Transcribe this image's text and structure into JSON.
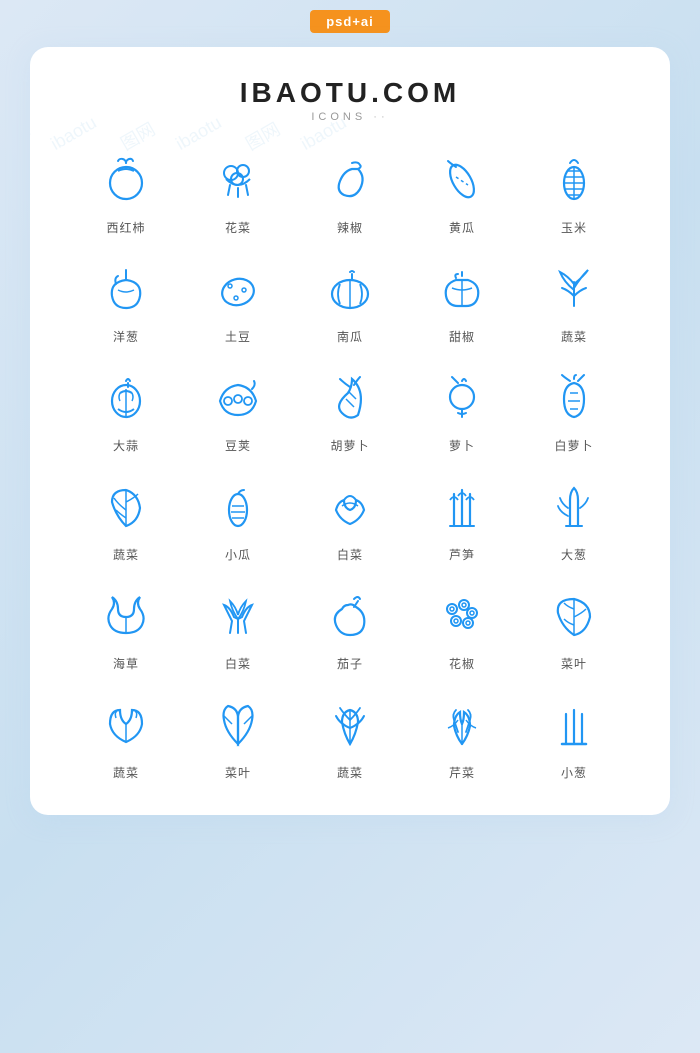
{
  "badge": "psd+ai",
  "card": {
    "title": "IBAOTU.COM",
    "subtitle": "ICONS",
    "icons": [
      {
        "id": "tomato",
        "label": "西红柿"
      },
      {
        "id": "cauliflower",
        "label": "花菜"
      },
      {
        "id": "chili",
        "label": "辣椒"
      },
      {
        "id": "cucumber",
        "label": "黄瓜"
      },
      {
        "id": "corn",
        "label": "玉米"
      },
      {
        "id": "onion",
        "label": "洋葱"
      },
      {
        "id": "potato",
        "label": "土豆"
      },
      {
        "id": "pumpkin",
        "label": "南瓜"
      },
      {
        "id": "bellpepper",
        "label": "甜椒"
      },
      {
        "id": "greens",
        "label": "蔬菜"
      },
      {
        "id": "garlic",
        "label": "大蒜"
      },
      {
        "id": "peas",
        "label": "豆荚"
      },
      {
        "id": "carrot",
        "label": "胡萝卜"
      },
      {
        "id": "radish",
        "label": "萝卜"
      },
      {
        "id": "whiteradish",
        "label": "白萝卜"
      },
      {
        "id": "leafyveg",
        "label": "蔬菜"
      },
      {
        "id": "zucchini",
        "label": "小瓜"
      },
      {
        "id": "cabbage",
        "label": "白菜"
      },
      {
        "id": "asparagus",
        "label": "芦笋"
      },
      {
        "id": "greenonion2",
        "label": "大葱"
      },
      {
        "id": "seaweed",
        "label": "海草"
      },
      {
        "id": "bokchoy",
        "label": "白菜"
      },
      {
        "id": "eggplant",
        "label": "茄子"
      },
      {
        "id": "sichuan",
        "label": "花椒"
      },
      {
        "id": "leaf",
        "label": "菜叶"
      },
      {
        "id": "herbs",
        "label": "蔬菜"
      },
      {
        "id": "leafb",
        "label": "菜叶"
      },
      {
        "id": "herbsc",
        "label": "蔬菜"
      },
      {
        "id": "celery",
        "label": "芹菜"
      },
      {
        "id": "chives",
        "label": "小葱"
      }
    ]
  }
}
